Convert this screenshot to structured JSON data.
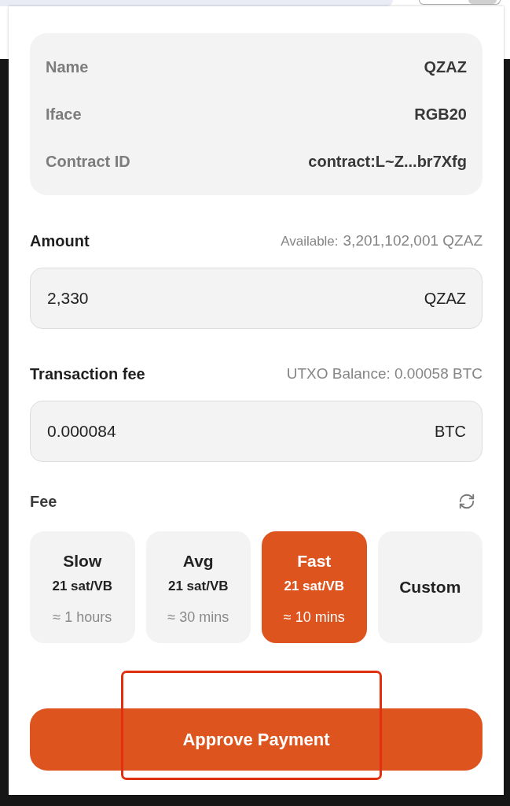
{
  "asset_info": {
    "rows": [
      {
        "label": "Name",
        "value": "QZAZ"
      },
      {
        "label": "Iface",
        "value": "RGB20"
      },
      {
        "label": "Contract ID",
        "value": "contract:L~Z...br7Xfg"
      }
    ]
  },
  "amount": {
    "label": "Amount",
    "available_label": "Available:",
    "available_value": "3,201,102,001 QZAZ",
    "value": "2,330",
    "unit": "QZAZ"
  },
  "transaction_fee": {
    "label": "Transaction fee",
    "balance": "UTXO Balance: 0.00058 BTC",
    "value": "0.000084",
    "unit": "BTC"
  },
  "fee": {
    "label": "Fee",
    "options": [
      {
        "kind": "preset",
        "name": "Slow",
        "rate": "21 sat/VB",
        "time": "≈ 1 hours",
        "selected": false
      },
      {
        "kind": "preset",
        "name": "Avg",
        "rate": "21 sat/VB",
        "time": "≈ 30 mins",
        "selected": false
      },
      {
        "kind": "preset",
        "name": "Fast",
        "rate": "21 sat/VB",
        "time": "≈ 10 mins",
        "selected": true
      },
      {
        "kind": "custom",
        "name": "Custom",
        "selected": false
      }
    ]
  },
  "approve_button": {
    "label": "Approve Payment"
  },
  "annotation": {
    "kind": "highlight-box"
  }
}
